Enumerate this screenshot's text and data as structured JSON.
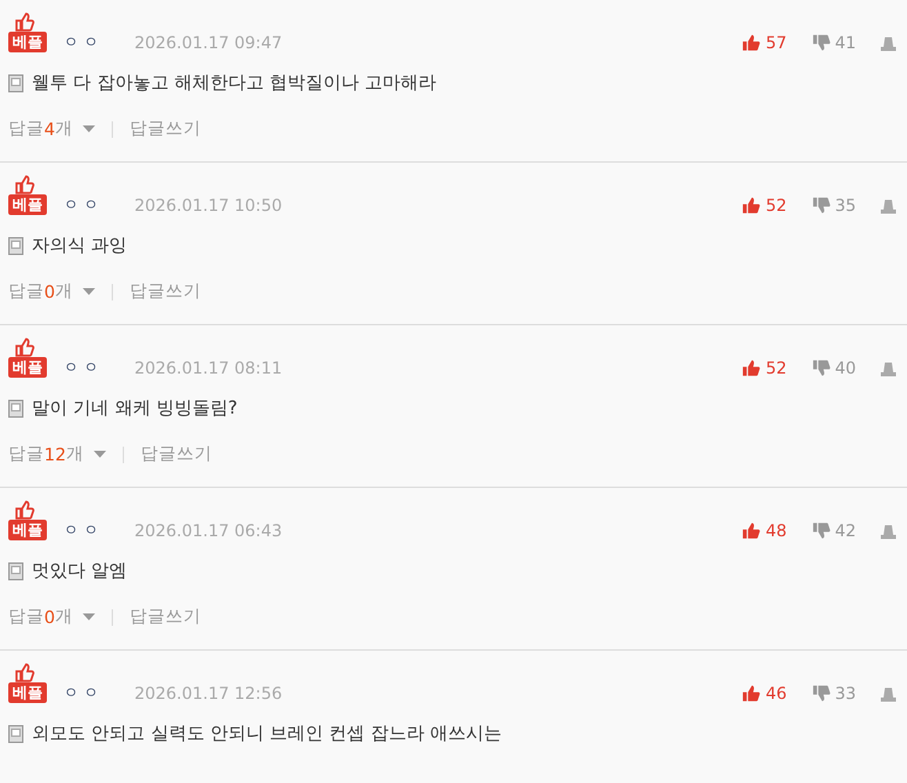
{
  "comments": [
    {
      "badge": "베플",
      "author": "ㅇ ㅇ",
      "time": "2026.01.17 09:47",
      "likes": "57",
      "dislikes": "41",
      "text": "웰투 다 잡아놓고 해체한다고 협박질이나 고마해라",
      "replies": {
        "label": "답글",
        "count": "4",
        "unit": "개"
      },
      "write_reply": "답글쓰기"
    },
    {
      "badge": "베플",
      "author": "ㅇ ㅇ",
      "time": "2026.01.17 10:50",
      "likes": "52",
      "dislikes": "35",
      "text": "자의식 과잉",
      "replies": {
        "label": "답글",
        "count": "0",
        "unit": "개"
      },
      "write_reply": "답글쓰기"
    },
    {
      "badge": "베플",
      "author": "ㅇ ㅇ",
      "time": "2026.01.17 08:11",
      "likes": "52",
      "dislikes": "40",
      "text": "말이 기네 왜케 빙빙돌림?",
      "replies": {
        "label": "답글",
        "count": "12",
        "unit": "개"
      },
      "write_reply": "답글쓰기"
    },
    {
      "badge": "베플",
      "author": "ㅇ ㅇ",
      "time": "2026.01.17 06:43",
      "likes": "48",
      "dislikes": "42",
      "text": "멋있다 알엠",
      "replies": {
        "label": "답글",
        "count": "0",
        "unit": "개"
      },
      "write_reply": "답글쓰기"
    },
    {
      "badge": "베플",
      "author": "ㅇ ㅇ",
      "time": "2026.01.17 12:56",
      "likes": "46",
      "dislikes": "33",
      "text": "외모도 안되고 실력도 안되니 브레인 컨셉 잡느라 애쓰시는"
    }
  ]
}
